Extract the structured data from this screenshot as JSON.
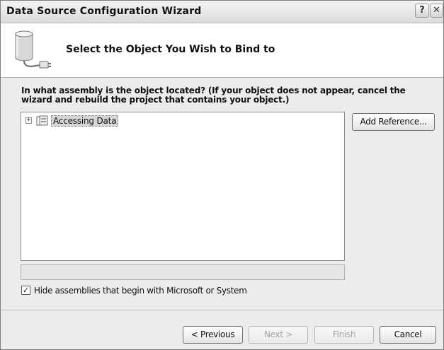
{
  "window": {
    "title": "Data Source Configuration Wizard",
    "help_glyph": "?",
    "close_glyph": "✕"
  },
  "header": {
    "icon": "database-icon",
    "title": "Select the Object You Wish to Bind to"
  },
  "main": {
    "question": "In what assembly is the object located? (If your object does not appear, cancel the wizard and rebuild the project that contains your object.)",
    "tree": {
      "items": [
        {
          "label": "Accessing Data",
          "expander": "+",
          "icon": "assembly-icon",
          "selected": true
        }
      ]
    },
    "add_reference_label": "Add Reference...",
    "description_text": "",
    "hide_assemblies": {
      "label": "Hide assemblies that begin with Microsoft or System",
      "checked": true,
      "check_glyph": "✓"
    }
  },
  "footer": {
    "previous_label": "< Previous",
    "next_label": "Next >",
    "finish_label": "Finish",
    "cancel_label": "Cancel",
    "next_enabled": false,
    "finish_enabled": false
  }
}
